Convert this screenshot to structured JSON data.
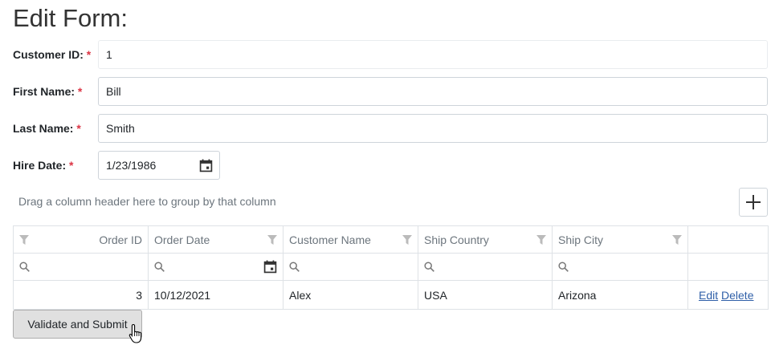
{
  "form": {
    "title": "Edit Form:",
    "required_marker": "*",
    "fields": [
      {
        "label": "Customer ID:",
        "value": "1"
      },
      {
        "label": "First Name:",
        "value": "Bill"
      },
      {
        "label": "Last Name:",
        "value": "Smith"
      },
      {
        "label": "Hire Date:",
        "value": "1/23/1986"
      }
    ]
  },
  "grid": {
    "group_panel_hint": "Drag a column header here to group by that column",
    "columns": [
      "Order ID",
      "Order Date",
      "Customer Name",
      "Ship Country",
      "Ship City"
    ],
    "rows": [
      {
        "order_id": "3",
        "order_date": "10/12/2021",
        "customer_name": "Alex",
        "ship_country": "USA",
        "ship_city": "Arizona",
        "edit": "Edit",
        "delete": "Delete"
      }
    ]
  },
  "submit_label": "Validate and Submit",
  "colors": {
    "required": "#dc3545",
    "link": "#2f5fa8",
    "border": "#dee2e6"
  }
}
